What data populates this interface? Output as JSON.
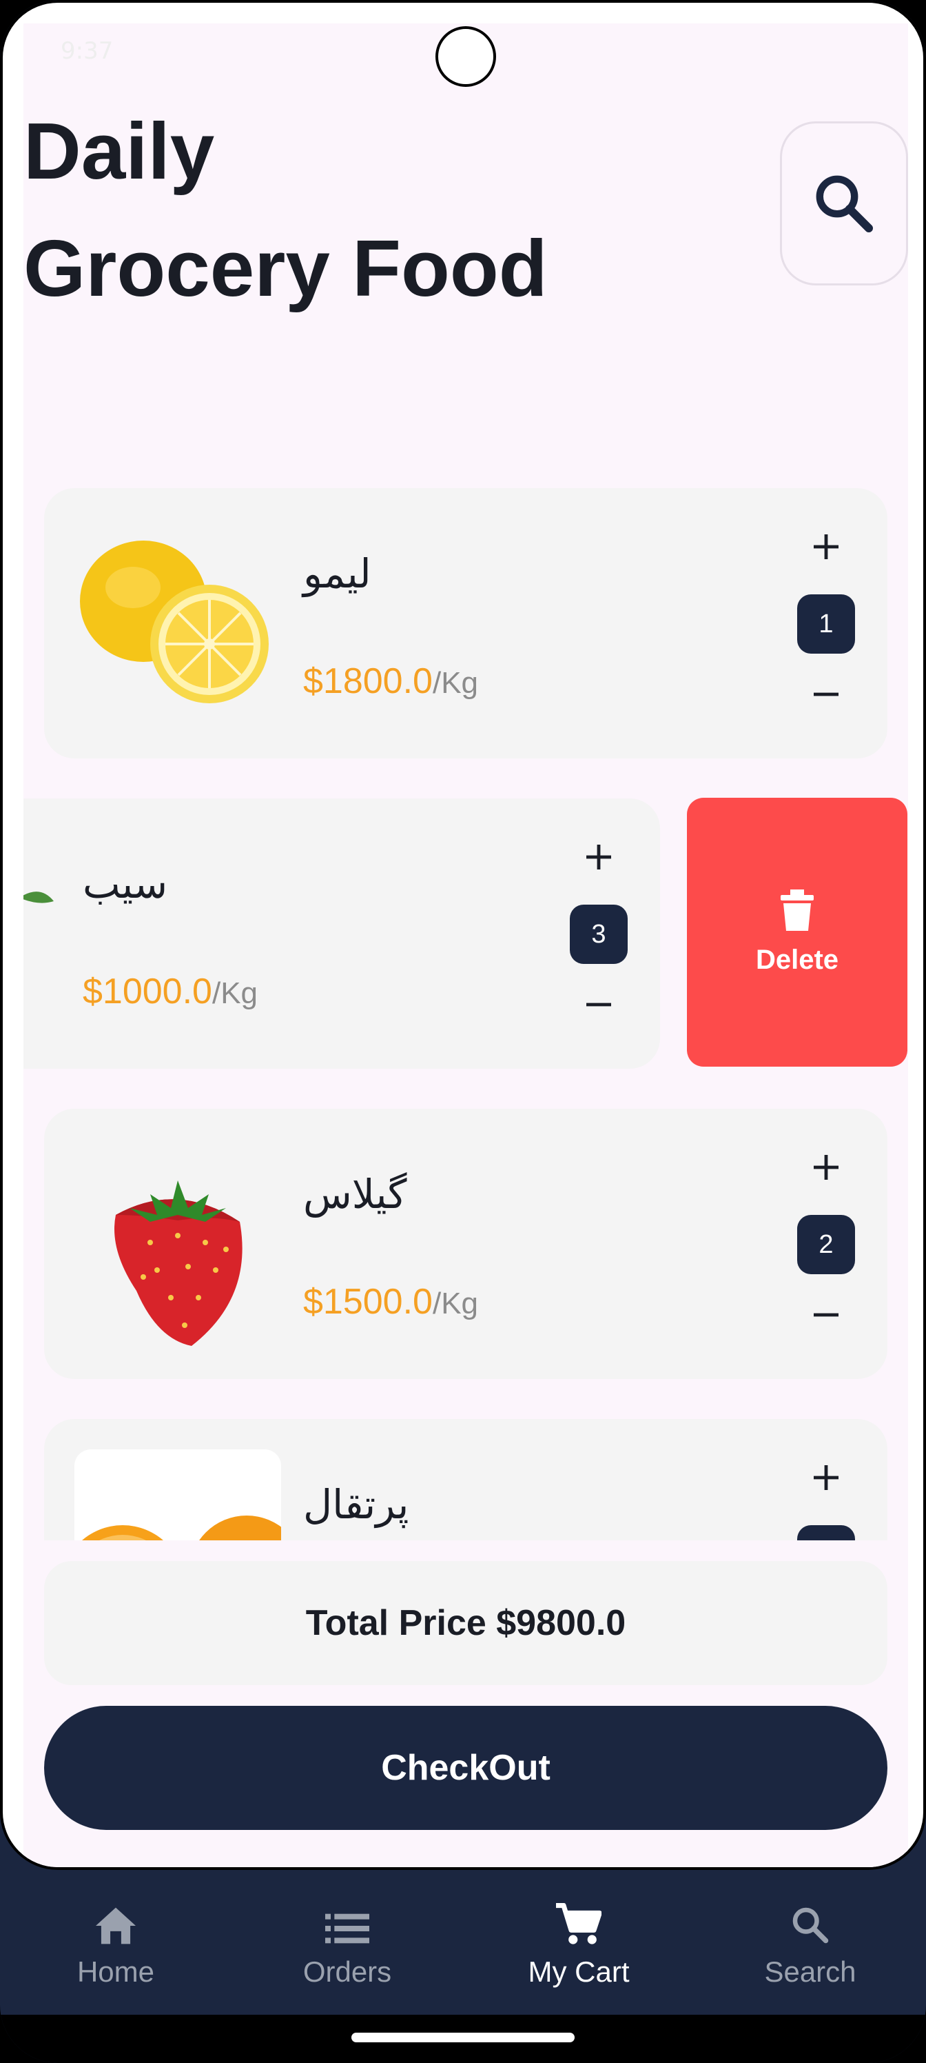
{
  "status": {
    "time": "9:37"
  },
  "header": {
    "title_line1": "Daily",
    "title_line2": "Grocery Food"
  },
  "cart": {
    "items": [
      {
        "name": "لیمو",
        "price": "$1800.0",
        "unit": "/Kg",
        "qty": "1",
        "image": "lemon"
      },
      {
        "name": "سیب",
        "price": "$1000.0",
        "unit": "/Kg",
        "qty": "3",
        "image": "apple"
      },
      {
        "name": "گیلاس",
        "price": "$1500.0",
        "unit": "/Kg",
        "qty": "2",
        "image": "strawberry"
      },
      {
        "name": "پرتقال",
        "price": "",
        "unit": "",
        "qty": "",
        "image": "orange"
      }
    ],
    "delete_label": "Delete",
    "total_label": "Total Price $9800.0",
    "checkout_label": "CheckOut"
  },
  "nav": {
    "items": [
      {
        "label": "Home",
        "icon": "home-icon"
      },
      {
        "label": "Orders",
        "icon": "list-icon"
      },
      {
        "label": "My Cart",
        "icon": "cart-icon",
        "active": true
      },
      {
        "label": "Search",
        "icon": "search-icon"
      }
    ]
  },
  "colors": {
    "navy": "#1b2640",
    "price": "#f5a023",
    "delete": "#fd4b4b",
    "card": "#f4f4f4"
  }
}
